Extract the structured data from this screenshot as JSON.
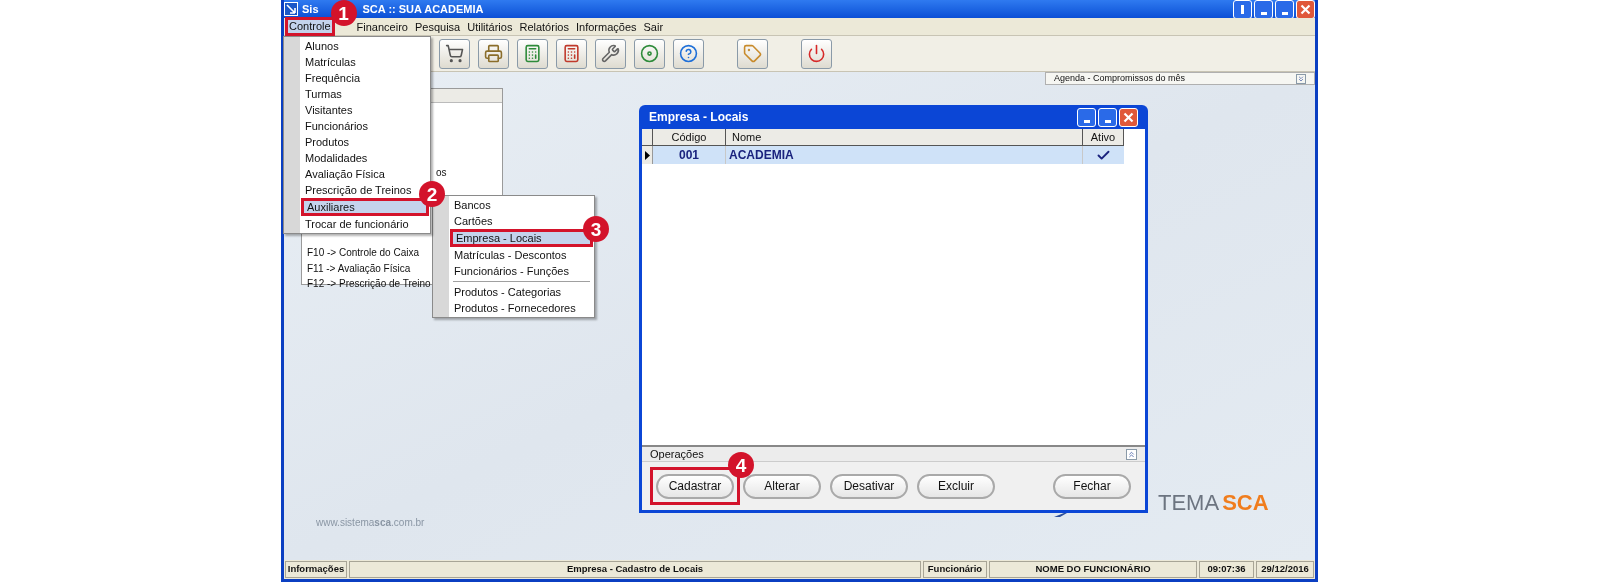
{
  "window": {
    "title_start": "Sis",
    "title_end": "SCA :: SUA ACADEMIA"
  },
  "menu_bar": [
    {
      "label": "Controle",
      "selected": true,
      "annotation": "1"
    },
    {
      "label": "Financeiro",
      "selected": false
    },
    {
      "label": "Pesquisa",
      "selected": false
    },
    {
      "label": "Utilitários",
      "selected": false
    },
    {
      "label": "Relatórios",
      "selected": false
    },
    {
      "label": "Informações",
      "selected": false
    },
    {
      "label": "Sair",
      "selected": false
    }
  ],
  "toolbar_groups": [
    [
      {
        "kind": "cart"
      },
      {
        "kind": "register"
      },
      {
        "kind": "calc_add"
      },
      {
        "kind": "calc_remove"
      },
      {
        "kind": "tools"
      },
      {
        "kind": "install"
      },
      {
        "kind": "help"
      }
    ],
    [
      {
        "kind": "tag"
      }
    ],
    [
      {
        "kind": "power"
      }
    ]
  ],
  "agenda": {
    "label": "Agenda - Compromissos do mês"
  },
  "shortcut_panel": {
    "partial_line": "os",
    "lines": [
      "F10 -> Controle do Caixa",
      "F11 -> Avaliação Física",
      "F12 -> Prescrição de Treino"
    ]
  },
  "controle_menu": [
    {
      "label": "Alunos",
      "selected": false
    },
    {
      "label": "Matrículas",
      "selected": false
    },
    {
      "label": "Frequência",
      "selected": false
    },
    {
      "label": "Turmas",
      "selected": false
    },
    {
      "label": "Visitantes",
      "selected": false
    },
    {
      "label": "Funcionários",
      "selected": false
    },
    {
      "label": "Produtos",
      "selected": false
    },
    {
      "label": "Modalidades",
      "selected": false
    },
    {
      "label": "Avaliação Física",
      "selected": false
    },
    {
      "label": "Prescrição de Treinos",
      "selected": false
    },
    {
      "label": "Auxiliares",
      "selected": true,
      "annotation": "2"
    },
    {
      "label": "Trocar de funcionário",
      "selected": false
    }
  ],
  "auxiliares_menu_groups": [
    [
      {
        "label": "Bancos",
        "selected": false
      },
      {
        "label": "Cartões",
        "selected": false
      },
      {
        "label": "Empresa - Locais",
        "selected": true,
        "annotation": "3"
      },
      {
        "label": "Matrículas - Descontos",
        "selected": false
      },
      {
        "label": "Funcionários - Funções",
        "selected": false
      }
    ],
    [
      {
        "label": "Produtos - Categorias",
        "selected": false
      },
      {
        "label": "Produtos - Fornecedores",
        "selected": false
      }
    ]
  ],
  "dialog": {
    "title": "Empresa - Locais",
    "columns": [
      "Código",
      "Nome",
      "Ativo"
    ],
    "rows": [
      {
        "codigo": "001",
        "nome": "ACADEMIA",
        "ativo": true,
        "selected": true
      }
    ],
    "operations_label": "Operações",
    "buttons": [
      {
        "label": "Cadastrar",
        "annotation": "4"
      },
      {
        "label": "Alterar"
      },
      {
        "label": "Desativar"
      },
      {
        "label": "Excluir"
      }
    ],
    "right_buttons": [
      {
        "label": "Fechar"
      }
    ]
  },
  "website": "www.sistema**sca**.com.br",
  "logo": {
    "part1": "TEMA",
    "part2": "SCA"
  },
  "status_bar": [
    {
      "text": "Informações"
    },
    {
      "text": "Empresa - Cadastro de Locais"
    },
    {
      "text": "Funcionário"
    },
    {
      "text": "NOME DO FUNCIONÁRIO"
    },
    {
      "text": "09:07:36"
    },
    {
      "text": "29/12/2016"
    }
  ]
}
